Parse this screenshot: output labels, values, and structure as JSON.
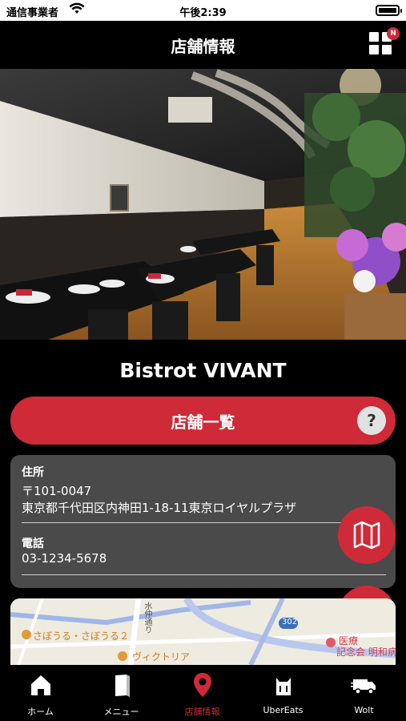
{
  "status_bar": {
    "carrier": "通信事業者",
    "time": "午後2:39"
  },
  "header": {
    "title": "店舗情報",
    "badge": "N"
  },
  "shop": {
    "name": "Bistrot VIVANT"
  },
  "store_list_button": {
    "label": "店舗一覧",
    "help": "?"
  },
  "info": {
    "address_label": "住所",
    "postal_code": "〒101-0047",
    "address": "東京都千代田区内神田1-18-11東京ロイヤルプラザ",
    "phone_label": "電話",
    "phone": "03-1234-5678"
  },
  "map": {
    "labels": [
      "さぼうる・さぼうる２",
      "ヴィクトリア",
      "302",
      "水仲通り",
      "医療",
      "記念会 明和病"
    ]
  },
  "tabs": [
    {
      "label": "ホーム",
      "icon": "home-icon"
    },
    {
      "label": "メニュー",
      "icon": "menu-book-icon"
    },
    {
      "label": "店舗情報",
      "icon": "map-pin-icon",
      "active": true
    },
    {
      "label": "UberEats",
      "icon": "uber-eats-icon"
    },
    {
      "label": "Wolt",
      "icon": "delivery-truck-icon"
    }
  ],
  "colors": {
    "accent": "#cf2a37",
    "card": "#4a4a4a",
    "background": "#000000"
  }
}
